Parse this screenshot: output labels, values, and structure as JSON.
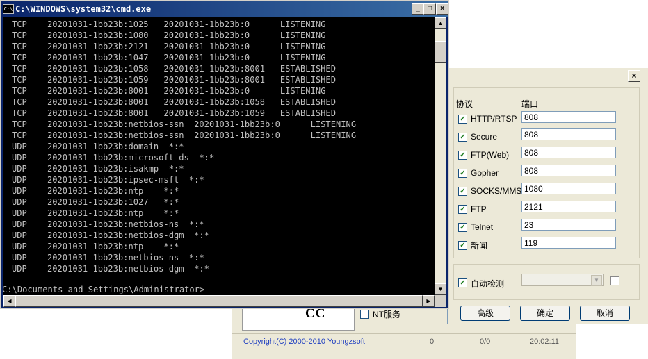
{
  "cmd": {
    "title": "C:\\WINDOWS\\system32\\cmd.exe",
    "icon": "cmd-icon",
    "lines": [
      "TCP    20201031-1bb23b:1025   20201031-1bb23b:0      LISTENING",
      "TCP    20201031-1bb23b:1080   20201031-1bb23b:0      LISTENING",
      "TCP    20201031-1bb23b:2121   20201031-1bb23b:0      LISTENING",
      "TCP    20201031-1bb23b:1047   20201031-1bb23b:0      LISTENING",
      "TCP    20201031-1bb23b:1058   20201031-1bb23b:8001   ESTABLISHED",
      "TCP    20201031-1bb23b:1059   20201031-1bb23b:8001   ESTABLISHED",
      "TCP    20201031-1bb23b:8001   20201031-1bb23b:0      LISTENING",
      "TCP    20201031-1bb23b:8001   20201031-1bb23b:1058   ESTABLISHED",
      "TCP    20201031-1bb23b:8001   20201031-1bb23b:1059   ESTABLISHED",
      "TCP    20201031-1bb23b:netbios-ssn  20201031-1bb23b:0      LISTENING",
      "TCP    20201031-1bb23b:netbios-ssn  20201031-1bb23b:0      LISTENING",
      "UDP    20201031-1bb23b:domain  *:*",
      "UDP    20201031-1bb23b:microsoft-ds  *:*",
      "UDP    20201031-1bb23b:isakmp  *:*",
      "UDP    20201031-1bb23b:ipsec-msft  *:*",
      "UDP    20201031-1bb23b:ntp    *:*",
      "UDP    20201031-1bb23b:1027   *:*",
      "UDP    20201031-1bb23b:ntp    *:*",
      "UDP    20201031-1bb23b:netbios-ns  *:*",
      "UDP    20201031-1bb23b:netbios-dgm  *:*",
      "UDP    20201031-1bb23b:ntp    *:*",
      "UDP    20201031-1bb23b:netbios-ns  *:*",
      "UDP    20201031-1bb23b:netbios-dgm  *:*"
    ],
    "prompt": "C:\\Documents and Settings\\Administrator>"
  },
  "dialog": {
    "header_protocol": "协议",
    "header_port": "端口",
    "rows": [
      {
        "label": "HTTP/RTSP",
        "port": "808",
        "checked": true
      },
      {
        "label": "Secure",
        "port": "808",
        "checked": true
      },
      {
        "label": "FTP(Web)",
        "port": "808",
        "checked": true
      },
      {
        "label": "Gopher",
        "port": "808",
        "checked": true
      },
      {
        "label": "SOCKS/MMS",
        "port": "1080",
        "checked": true
      },
      {
        "label": "FTP",
        "port": "2121",
        "checked": true
      },
      {
        "label": "Telnet",
        "port": "23",
        "checked": true
      },
      {
        "label": "新闻",
        "port": "119",
        "checked": true
      }
    ],
    "auto_detect_label": "自动检测",
    "buttons": {
      "advanced": "高级",
      "ok": "确定",
      "cancel": "取消"
    },
    "close_glyph": "×"
  },
  "background_app": {
    "banner_text": "CC",
    "nt_service_label": "NT服务",
    "copyright": "Copyright(C) 2000-2010 Youngzsoft",
    "status_cells": [
      "0",
      "0/0",
      "20:02:11"
    ]
  },
  "colors": {
    "titlebar_start": "#0a246a",
    "titlebar_end": "#3a6ea5",
    "console_bg": "#000000",
    "console_fg": "#c0c0c0",
    "dialog_bg": "#ece9d8"
  }
}
